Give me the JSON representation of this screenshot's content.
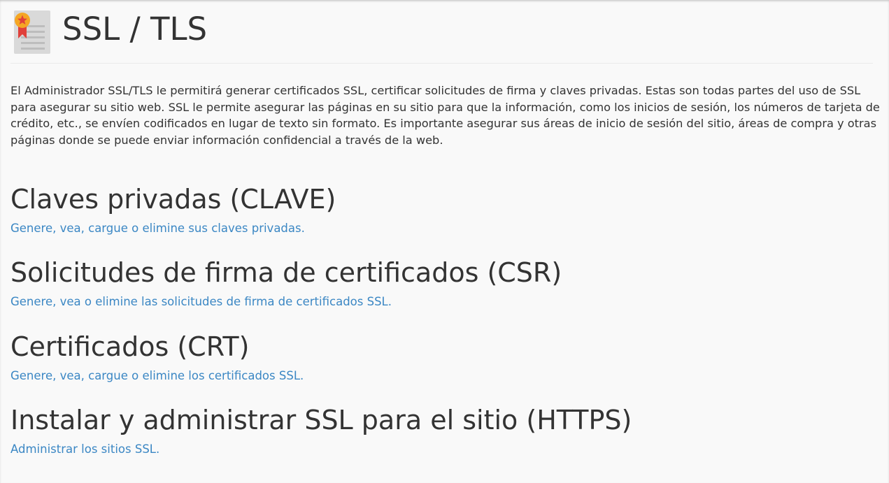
{
  "header": {
    "title": "SSL / TLS",
    "icon": "ssl-certificate-icon"
  },
  "description": "El Administrador SSL/TLS le permitirá generar certificados SSL, certificar solicitudes de firma y claves privadas. Estas son todas partes del uso de SSL para asegurar su sitio web. SSL le permite asegurar las páginas en su sitio para que la información, como los inicios de sesión, los números de tarjeta de crédito, etc., se envíen codificados en lugar de texto sin formato. Es importante asegurar sus áreas de inicio de sesión del sitio, áreas de compra y otras páginas donde se puede enviar información confidencial a través de la web.",
  "sections": [
    {
      "heading": "Claves privadas (CLAVE)",
      "link": "Genere, vea, cargue o elimine sus claves privadas."
    },
    {
      "heading": "Solicitudes de firma de certificados (CSR)",
      "link": "Genere, vea o elimine las solicitudes de firma de certificados SSL."
    },
    {
      "heading": "Certificados (CRT)",
      "link": "Genere, vea, cargue o elimine los certificados SSL."
    },
    {
      "heading": "Instalar y administrar SSL para el sitio (HTTPS)",
      "link": "Administrar los sitios SSL."
    }
  ],
  "colors": {
    "link": "#3b87c4",
    "text": "#333333",
    "background": "#f9f9f9",
    "icon_star": "#f5a623",
    "icon_ribbon": "#e0403a"
  }
}
